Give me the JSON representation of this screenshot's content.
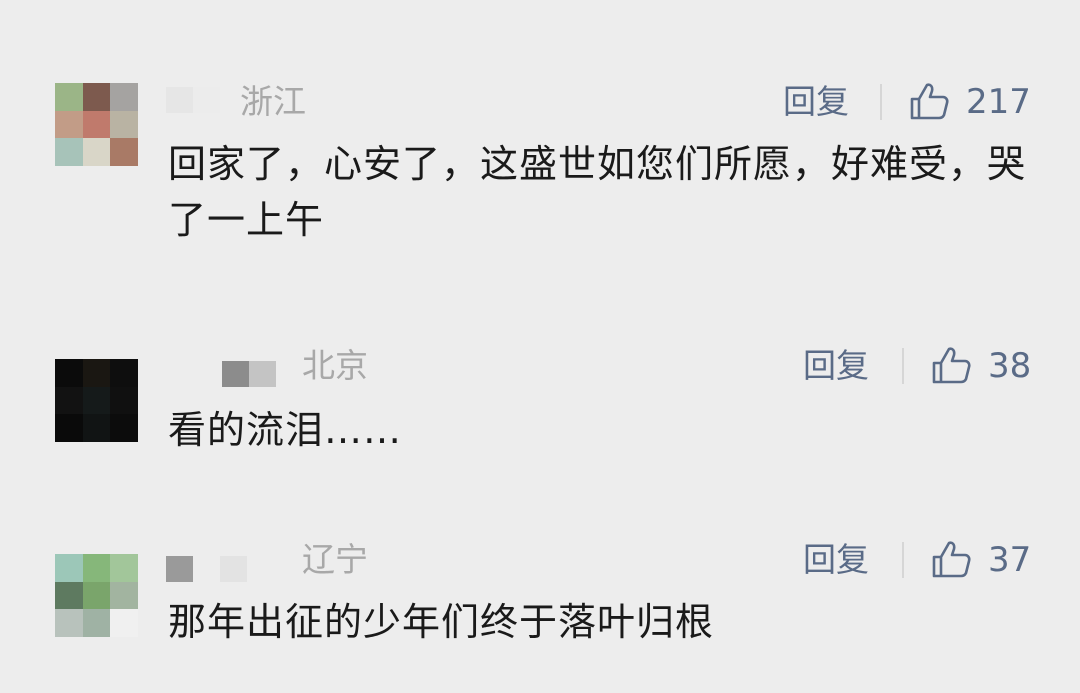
{
  "comments": [
    {
      "region": "浙江",
      "reply_label": "回复",
      "likes": "217",
      "text": "回家了，心安了，这盛世如您们所愿，好难受，哭了一上午",
      "avatar_colors": [
        "#9bb587",
        "#7d5a4e",
        "#a5a3a1",
        "#c29c87",
        "#c07a6c",
        "#b9b3a3",
        "#a7c3b9",
        "#d9d6c8",
        "#a97a66"
      ]
    },
    {
      "region": "北京",
      "reply_label": "回复",
      "likes": "38",
      "text": "看的流泪……",
      "avatar_colors": [
        "#0b0b0b",
        "#1a1712",
        "#0e0e0e",
        "#121212",
        "#151a1a",
        "#101010",
        "#0a0a0a",
        "#111414",
        "#0c0c0c"
      ]
    },
    {
      "region": "辽宁",
      "reply_label": "回复",
      "likes": "37",
      "text": "那年出征的少年们终于落叶归根",
      "avatar_colors": [
        "#9cc7b8",
        "#86b77a",
        "#a2c69a",
        "#5e7a60",
        "#7aa56b",
        "#a2b4a0",
        "#b8c2bc",
        "#9fb2a4",
        "#f0f0f0"
      ]
    }
  ]
}
